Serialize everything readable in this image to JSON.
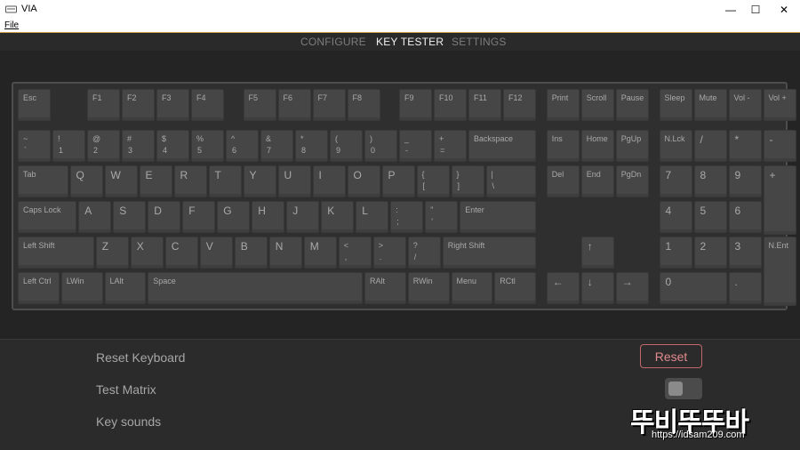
{
  "window": {
    "title": "VIA",
    "minimize": "—",
    "maximize": "☐",
    "close": "✕"
  },
  "menu": {
    "file": "File"
  },
  "tabs": [
    {
      "label": "CONFIGURE",
      "active": false
    },
    {
      "label": "KEY TESTER",
      "active": true
    },
    {
      "label": "SETTINGS",
      "active": false
    }
  ],
  "keys": [
    {
      "id": "esc",
      "top": "Esc"
    },
    {
      "id": "f1",
      "top": "F1"
    },
    {
      "id": "f2",
      "top": "F2"
    },
    {
      "id": "f3",
      "top": "F3"
    },
    {
      "id": "f4",
      "top": "F4"
    },
    {
      "id": "f5",
      "top": "F5"
    },
    {
      "id": "f6",
      "top": "F6"
    },
    {
      "id": "f7",
      "top": "F7"
    },
    {
      "id": "f8",
      "top": "F8"
    },
    {
      "id": "f9",
      "top": "F9"
    },
    {
      "id": "f10",
      "top": "F10"
    },
    {
      "id": "f11",
      "top": "F11"
    },
    {
      "id": "f12",
      "top": "F12"
    },
    {
      "id": "print",
      "top": "Print"
    },
    {
      "id": "scroll",
      "top": "Scroll"
    },
    {
      "id": "pause",
      "top": "Pause"
    },
    {
      "id": "sleep",
      "top": "Sleep"
    },
    {
      "id": "mute",
      "top": "Mute"
    },
    {
      "id": "vol-down",
      "top": "Vol -"
    },
    {
      "id": "vol-up",
      "top": "Vol +"
    },
    {
      "id": "grave",
      "top": "~",
      "bottom": "`"
    },
    {
      "id": "1",
      "top": "!",
      "bottom": "1"
    },
    {
      "id": "2",
      "top": "@",
      "bottom": "2"
    },
    {
      "id": "3",
      "top": "#",
      "bottom": "3"
    },
    {
      "id": "4",
      "top": "$",
      "bottom": "4"
    },
    {
      "id": "5",
      "top": "%",
      "bottom": "5"
    },
    {
      "id": "6",
      "top": "^",
      "bottom": "6"
    },
    {
      "id": "7",
      "top": "&",
      "bottom": "7"
    },
    {
      "id": "8",
      "top": "*",
      "bottom": "8"
    },
    {
      "id": "9",
      "top": "(",
      "bottom": "9"
    },
    {
      "id": "0",
      "top": ")",
      "bottom": "0"
    },
    {
      "id": "minus",
      "top": "_",
      "bottom": "-"
    },
    {
      "id": "equal",
      "top": "+",
      "bottom": "="
    },
    {
      "id": "backspace",
      "top": "Backspace"
    },
    {
      "id": "ins",
      "top": "Ins"
    },
    {
      "id": "home",
      "top": "Home"
    },
    {
      "id": "pgup",
      "top": "PgUp"
    },
    {
      "id": "numlock",
      "top": "N.Lck"
    },
    {
      "id": "np-slash",
      "top": "/"
    },
    {
      "id": "np-star",
      "top": "*"
    },
    {
      "id": "np-minus",
      "top": "-"
    },
    {
      "id": "tab",
      "top": "Tab"
    },
    {
      "id": "q",
      "top": "Q"
    },
    {
      "id": "w",
      "top": "W"
    },
    {
      "id": "e",
      "top": "E"
    },
    {
      "id": "r",
      "top": "R"
    },
    {
      "id": "t",
      "top": "T"
    },
    {
      "id": "y",
      "top": "Y"
    },
    {
      "id": "u",
      "top": "U"
    },
    {
      "id": "i",
      "top": "I"
    },
    {
      "id": "o",
      "top": "O"
    },
    {
      "id": "p",
      "top": "P"
    },
    {
      "id": "lbracket",
      "top": "{",
      "bottom": "["
    },
    {
      "id": "rbracket",
      "top": "}",
      "bottom": "]"
    },
    {
      "id": "backslash",
      "top": "|",
      "bottom": "\\"
    },
    {
      "id": "del",
      "top": "Del"
    },
    {
      "id": "end",
      "top": "End"
    },
    {
      "id": "pgdn",
      "top": "PgDn"
    },
    {
      "id": "np7",
      "top": "7"
    },
    {
      "id": "np8",
      "top": "8"
    },
    {
      "id": "np9",
      "top": "9"
    },
    {
      "id": "np-plus",
      "top": "+"
    },
    {
      "id": "caps",
      "top": "Caps Lock"
    },
    {
      "id": "a",
      "top": "A"
    },
    {
      "id": "s",
      "top": "S"
    },
    {
      "id": "d",
      "top": "D"
    },
    {
      "id": "f",
      "top": "F"
    },
    {
      "id": "g",
      "top": "G"
    },
    {
      "id": "h",
      "top": "H"
    },
    {
      "id": "j",
      "top": "J"
    },
    {
      "id": "k",
      "top": "K"
    },
    {
      "id": "l",
      "top": "L"
    },
    {
      "id": "semicolon",
      "top": ":",
      "bottom": ";"
    },
    {
      "id": "quote",
      "top": "\"",
      "bottom": "'"
    },
    {
      "id": "enter",
      "top": "Enter"
    },
    {
      "id": "np4",
      "top": "4"
    },
    {
      "id": "np5",
      "top": "5"
    },
    {
      "id": "np6",
      "top": "6"
    },
    {
      "id": "lshift",
      "top": "Left Shift"
    },
    {
      "id": "z",
      "top": "Z"
    },
    {
      "id": "x",
      "top": "X"
    },
    {
      "id": "c",
      "top": "C"
    },
    {
      "id": "v",
      "top": "V"
    },
    {
      "id": "b",
      "top": "B"
    },
    {
      "id": "n",
      "top": "N"
    },
    {
      "id": "m",
      "top": "M"
    },
    {
      "id": "comma",
      "top": "<",
      "bottom": ","
    },
    {
      "id": "period",
      "top": ">",
      "bottom": "."
    },
    {
      "id": "slash",
      "top": "?",
      "bottom": "/"
    },
    {
      "id": "rshift",
      "top": "Right Shift"
    },
    {
      "id": "up",
      "top": "↑"
    },
    {
      "id": "np1",
      "top": "1"
    },
    {
      "id": "np2",
      "top": "2"
    },
    {
      "id": "np3",
      "top": "3"
    },
    {
      "id": "np-enter",
      "top": "N.Ent"
    },
    {
      "id": "lctrl",
      "top": "Left Ctrl"
    },
    {
      "id": "lwin",
      "top": "LWin"
    },
    {
      "id": "lalt",
      "top": "LAlt"
    },
    {
      "id": "space",
      "top": "Space"
    },
    {
      "id": "ralt",
      "top": "RAlt"
    },
    {
      "id": "rwin",
      "top": "RWin"
    },
    {
      "id": "menu",
      "top": "Menu"
    },
    {
      "id": "rctl",
      "top": "RCtl"
    },
    {
      "id": "left",
      "top": "←"
    },
    {
      "id": "down",
      "top": "↓"
    },
    {
      "id": "right",
      "top": "→"
    },
    {
      "id": "np0",
      "top": "0"
    },
    {
      "id": "np-dot",
      "top": "."
    }
  ],
  "settings": {
    "reset_label": "Reset Keyboard",
    "reset_button": "Reset",
    "matrix_label": "Test Matrix",
    "matrix_on": false,
    "sounds_label": "Key sounds"
  },
  "watermark": {
    "brand": "뚜비뚜뚜바",
    "url": "https://idsam209.com"
  }
}
